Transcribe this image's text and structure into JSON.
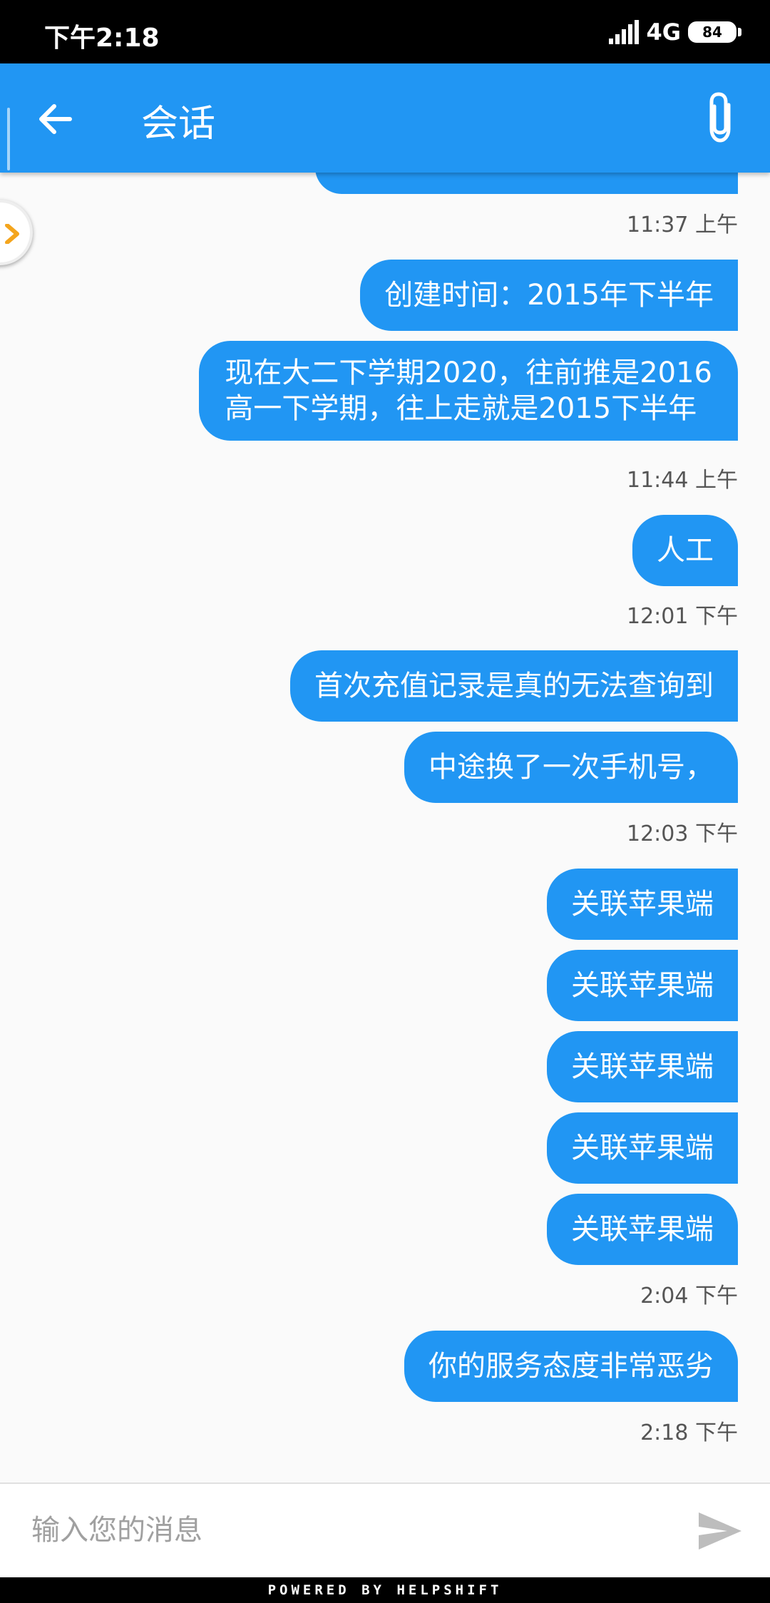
{
  "status_bar": {
    "time": "下午2:18",
    "network": "4G",
    "battery": "84"
  },
  "header": {
    "title": "会话",
    "back_icon": "arrow-left-icon",
    "attach_icon": "paperclip-icon"
  },
  "messages": [
    {
      "text": "创建时间：2015年下半年"
    },
    {
      "lines": [
        "现在大二下学期2020，往前推是2016",
        "高一下学期，往上走就是2015下半年"
      ]
    },
    {
      "text": "人工"
    },
    {
      "text": "首次充值记录是真的无法查询到"
    },
    {
      "text": "中途换了一次手机号，"
    },
    {
      "text": "关联苹果端"
    },
    {
      "text": "关联苹果端"
    },
    {
      "text": "关联苹果端"
    },
    {
      "text": "关联苹果端"
    },
    {
      "text": "关联苹果端"
    },
    {
      "text": "你的服务态度非常恶劣"
    }
  ],
  "timestamps": [
    "11:37 上午",
    "11:44 上午",
    "12:01 下午",
    "12:03 下午",
    "2:04 下午",
    "2:18 下午"
  ],
  "composer": {
    "placeholder": "输入您的消息",
    "send_icon": "send-icon"
  },
  "footer": {
    "text": "POWERED BY HELPSHIFT"
  },
  "colors": {
    "primary": "#2196f3",
    "background": "#fafafa",
    "status_bar": "#000000"
  }
}
